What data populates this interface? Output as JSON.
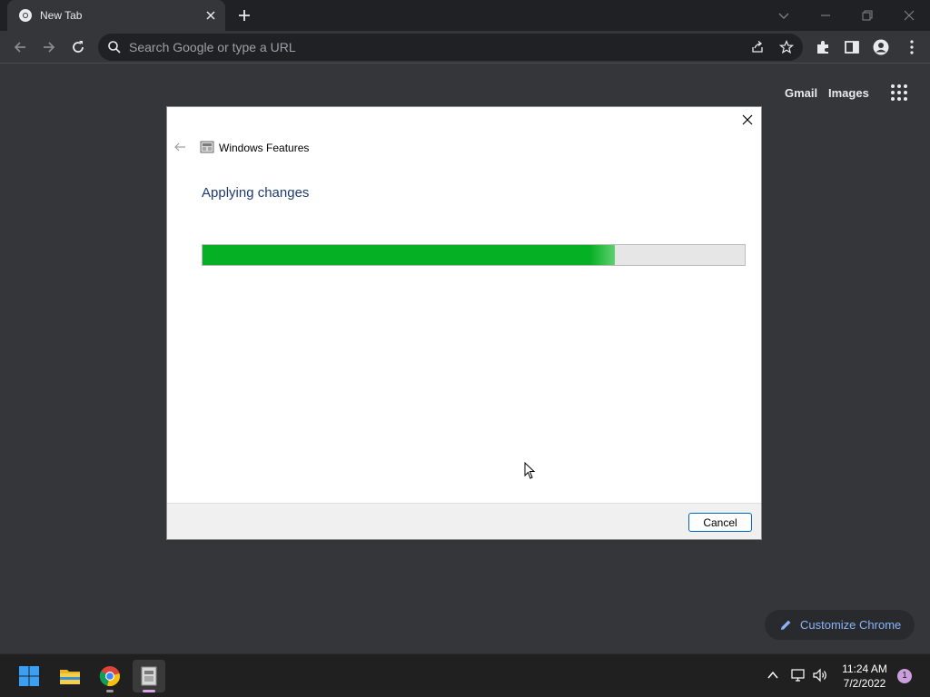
{
  "browser": {
    "tab": {
      "title": "New Tab",
      "favicon": "chrome-icon"
    },
    "omnibox": {
      "placeholder": "Search Google or type a URL"
    },
    "colors": {
      "frame": "#202124",
      "toolbar": "#35363a",
      "accent": "#8ab4f8"
    }
  },
  "ntp": {
    "links": [
      "Gmail",
      "Images"
    ],
    "customize_label": "Customize Chrome"
  },
  "dialog": {
    "title": "Windows Features",
    "heading": "Applying changes",
    "progress": 0.76,
    "progress_color": "#06b025",
    "cancel_label": "Cancel"
  },
  "taskbar": {
    "apps": [
      "start-icon",
      "file-explorer-icon",
      "chrome-icon",
      "windows-features-icon"
    ],
    "time": "11:24 AM",
    "date": "7/2/2022",
    "notification_count": "1"
  }
}
